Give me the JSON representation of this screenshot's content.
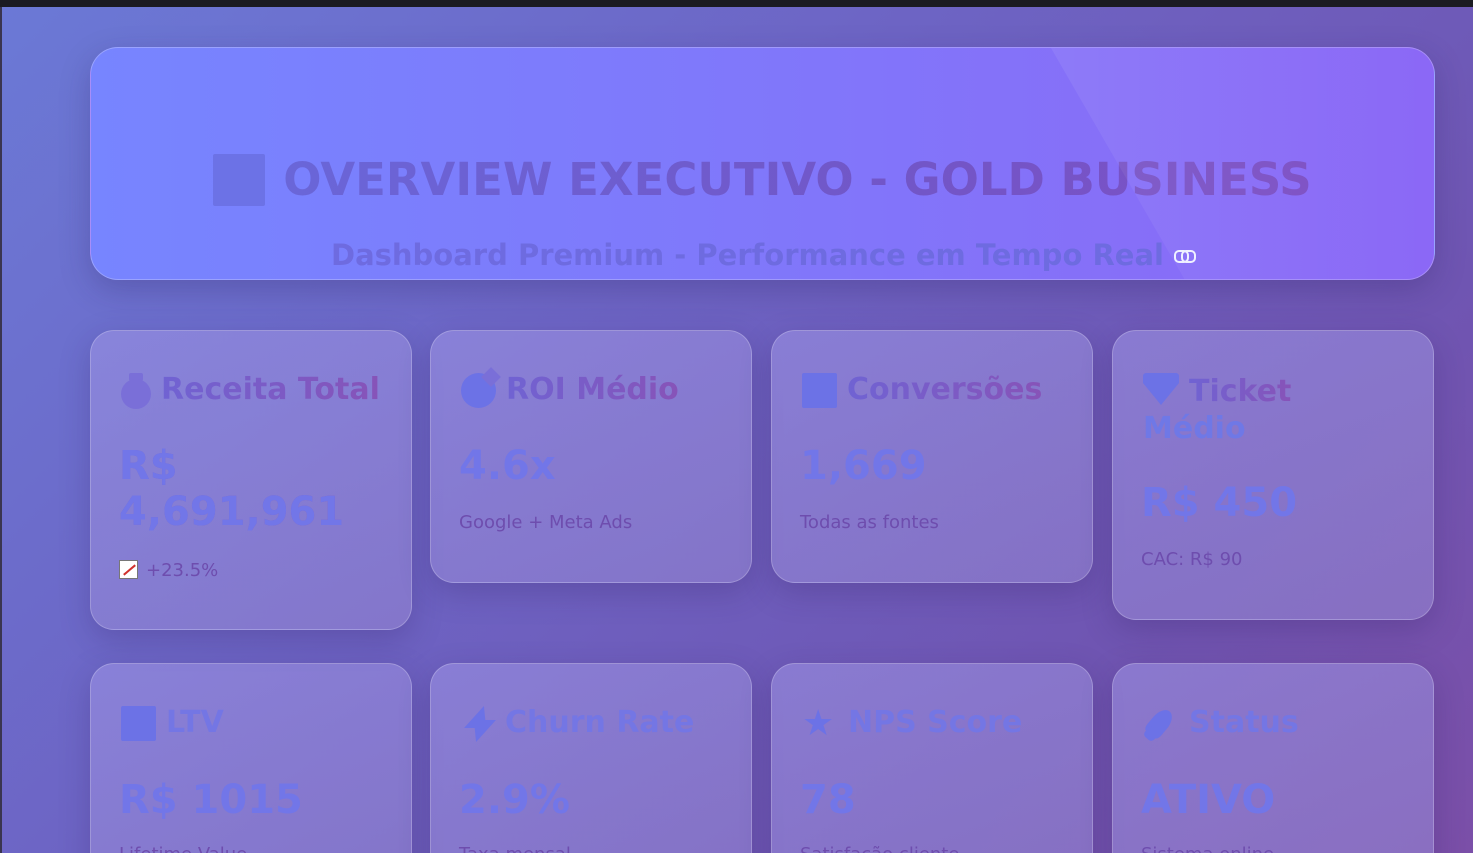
{
  "header": {
    "title": "OVERVIEW EXECUTIVO - GOLD BUSINESS",
    "title_icon": "bar-chart-icon",
    "subtitle": "Dashboard Premium - Performance em Tempo Real",
    "subtitle_icon": "link-icon"
  },
  "cards_row1": [
    {
      "icon": "money-bag-icon",
      "title_a": "Receita",
      "title_b": "Total",
      "value": "R$ 4,691,961",
      "sub": "+23.5%",
      "sub_icon": "chart-increasing-icon"
    },
    {
      "icon": "target-icon",
      "title_a": "ROI",
      "title_b": "Médio",
      "value": "4.6x",
      "sub": "Google + Meta Ads"
    },
    {
      "icon": "bar-chart-icon",
      "title_a": "Conversões",
      "title_b": "",
      "value": "1,669",
      "sub": "Todas as fontes"
    },
    {
      "icon": "gem-icon",
      "title_a": "Ticket",
      "title_b": "Médio",
      "value": "R$ 450",
      "sub": "CAC: R$ 90"
    }
  ],
  "cards_row2": [
    {
      "icon": "bar-chart-icon",
      "title": "LTV",
      "value": "R$ 1015",
      "sub": "Lifetime Value"
    },
    {
      "icon": "lightning-icon",
      "title": "Churn Rate",
      "value": "2.9%",
      "sub": "Taxa mensal"
    },
    {
      "icon": "star-icon",
      "title": "NPS Score",
      "value": "78",
      "sub": "Satisfação cliente"
    },
    {
      "icon": "rocket-icon",
      "title": "Status",
      "value": "ATIVO",
      "sub": "Sistema online"
    }
  ],
  "colors": {
    "accent": "#7a6fd8",
    "value": "#7276e8",
    "sub": "#6e4dae"
  }
}
